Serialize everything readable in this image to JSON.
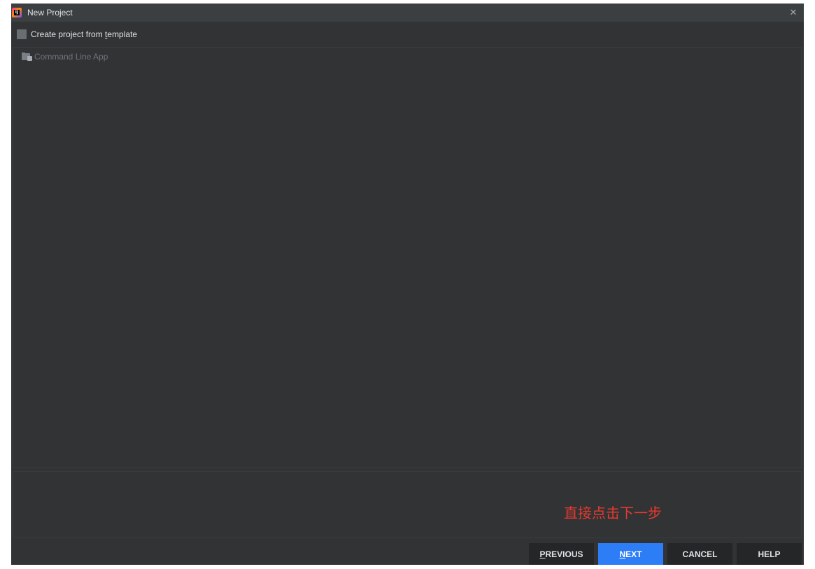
{
  "window": {
    "title": "New Project",
    "close_glyph": "✕",
    "app_icon_text": "IJ"
  },
  "template_toggle": {
    "label_prefix": "Create project from ",
    "label_mnemonic": "t",
    "label_suffix": "emplate",
    "checked": false
  },
  "templates": [
    {
      "label": "Command Line App",
      "icon": "folder-app-icon"
    }
  ],
  "annotation": {
    "text": "直接点击下一步",
    "color": "#e8392f"
  },
  "buttons": {
    "previous": {
      "mnemonic": "P",
      "rest": "REVIOUS"
    },
    "next": {
      "mnemonic": "N",
      "rest": "EXT"
    },
    "cancel": {
      "label": "CANCEL"
    },
    "help": {
      "label": "HELP"
    }
  },
  "colors": {
    "primary_button": "#2d7df6",
    "window_bg": "#313335",
    "titlebar_bg": "#3c3f41"
  }
}
